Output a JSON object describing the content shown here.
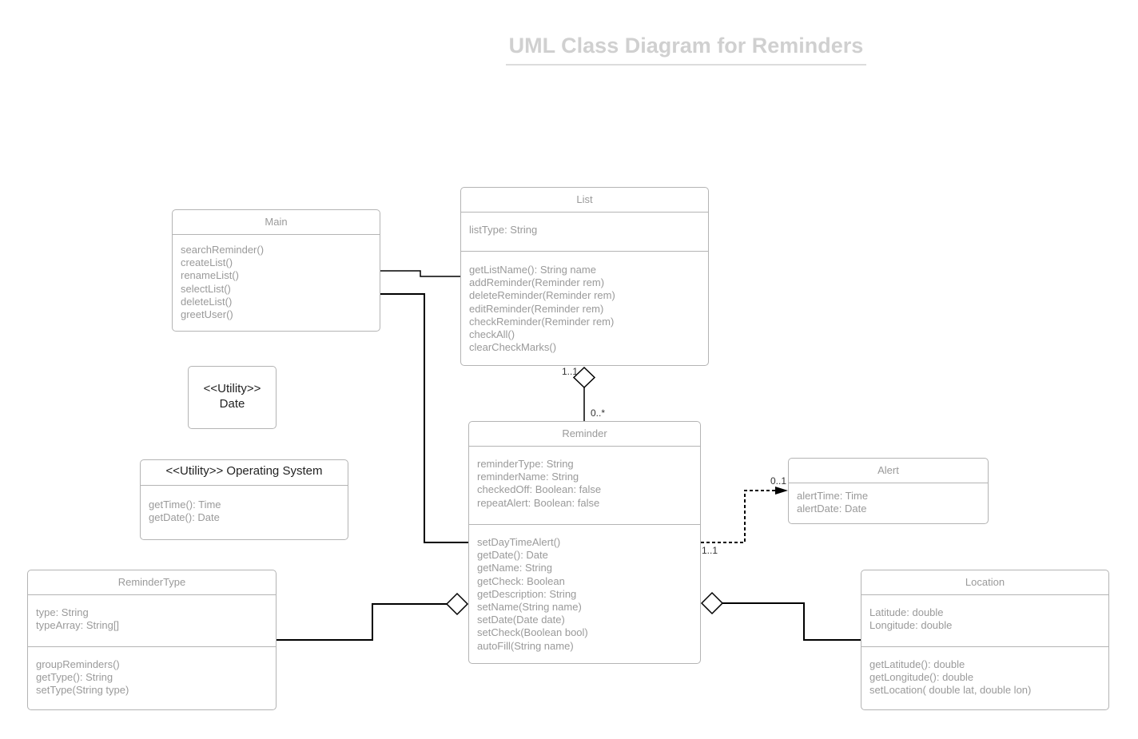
{
  "title": "UML Class Diagram for Reminders",
  "classes": {
    "main": {
      "name": "Main",
      "methods": [
        "searchReminder()",
        "createList()",
        "renameList()",
        "selectList()",
        "deleteList()",
        "greetUser()"
      ]
    },
    "list": {
      "name": "List",
      "attributes": [
        "listType: String"
      ],
      "methods": [
        "getListName(): String name",
        "addReminder(Reminder rem)",
        "deleteReminder(Reminder rem)",
        "editReminder(Reminder rem)",
        "checkReminder(Reminder rem)",
        "checkAll()",
        "clearCheckMarks()"
      ]
    },
    "reminder": {
      "name": "Reminder",
      "attributes": [
        "reminderType: String",
        "reminderName: String",
        "checkedOff: Boolean: false",
        "repeatAlert: Boolean: false"
      ],
      "methods": [
        "setDayTimeAlert()",
        "getDate(): Date",
        "getName: String",
        "getCheck: Boolean",
        "getDescription: String",
        "setName(String name)",
        "setDate(Date date)",
        "setCheck(Boolean bool)",
        "autoFill(String name)"
      ]
    },
    "alert": {
      "name": "Alert",
      "attributes": [
        "alertTime: Time",
        "alertDate: Date"
      ]
    },
    "reminder_type": {
      "name": "ReminderType",
      "attributes": [
        "type: String",
        "typeArray: String[]"
      ],
      "methods": [
        "groupReminders()",
        "getType(): String",
        "setType(String type)"
      ]
    },
    "location": {
      "name": "Location",
      "attributes": [
        "Latitude: double",
        "Longitude: double"
      ],
      "methods": [
        "getLatitude(): double",
        "getLongitude(): double",
        "setLocation( double lat, double lon)"
      ]
    },
    "date_utility": {
      "stereotype": "<<Utility>>",
      "name": "Date"
    },
    "os_utility": {
      "name": "<<Utility>> Operating System",
      "methods": [
        "getTime(): Time",
        "getDate(): Date"
      ]
    }
  },
  "multiplicities": {
    "list_side": "1..1",
    "reminder_side": "0..*",
    "alert_side": "0..1",
    "reminder_alert_side": "1..1"
  }
}
